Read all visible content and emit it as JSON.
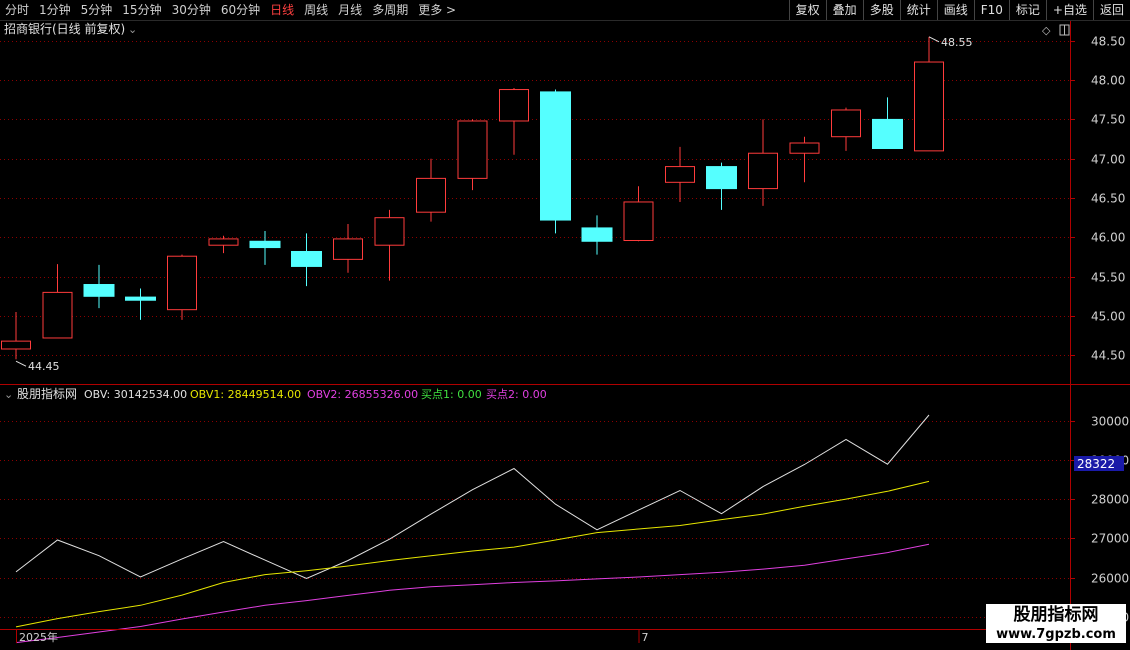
{
  "toolbar": {
    "periods": [
      "分时",
      "1分钟",
      "5分钟",
      "15分钟",
      "30分钟",
      "60分钟",
      "日线",
      "周线",
      "月线",
      "多周期",
      "更多 >"
    ],
    "active_index": 6,
    "buttons": [
      "复权",
      "叠加",
      "多股",
      "统计",
      "画线",
      "F10",
      "标记",
      "+自选",
      "返回"
    ]
  },
  "main_panel": {
    "title": "招商银行(日线 前复权)",
    "high_marker": "48.55",
    "low_marker": "44.45"
  },
  "indicator_panel": {
    "name": "股朋指标网",
    "legend": [
      {
        "label": "OBV: 30142534.00",
        "color": "#e0e0e0"
      },
      {
        "label": "OBV1: 28449514.00",
        "color": "#e6e600"
      },
      {
        "label": "OBV2: 26855326.00",
        "color": "#e040e0"
      },
      {
        "label": "买点1: 0.00",
        "color": "#40e040"
      },
      {
        "label": "买点2: 0.00",
        "color": "#e040e0"
      }
    ],
    "current_value_tag": "28322"
  },
  "x_axis": {
    "labels": [
      {
        "text": "2025年",
        "index": 0
      },
      {
        "text": "7",
        "index": 15
      }
    ]
  },
  "watermark": {
    "line1": "股朋指标网",
    "line2": "www.7gpzb.com"
  },
  "colors": {
    "up": "#ff3c3c",
    "down": "#55ffff",
    "grid": "#8b0000",
    "obv": "#e0e0e0",
    "obv1": "#e6e600",
    "obv2": "#e040e0"
  },
  "chart_data": [
    {
      "type": "candlestick",
      "title": "招商银行(日线 前复权)",
      "ylim": [
        44.3,
        48.65
      ],
      "y_ticks": [
        44.5,
        45.0,
        45.5,
        46.0,
        46.5,
        47.0,
        47.5,
        48.0,
        48.5
      ],
      "candles": [
        {
          "o": 44.58,
          "c": 44.68,
          "h": 45.05,
          "l": 44.45
        },
        {
          "o": 44.72,
          "c": 45.3,
          "h": 45.66,
          "l": 44.72
        },
        {
          "o": 45.4,
          "c": 45.25,
          "h": 45.65,
          "l": 45.1
        },
        {
          "o": 45.24,
          "c": 45.2,
          "h": 45.35,
          "l": 44.95
        },
        {
          "o": 45.08,
          "c": 45.76,
          "h": 45.78,
          "l": 44.95
        },
        {
          "o": 45.9,
          "c": 45.98,
          "h": 46.02,
          "l": 45.8
        },
        {
          "o": 45.95,
          "c": 45.87,
          "h": 46.08,
          "l": 45.65
        },
        {
          "o": 45.82,
          "c": 45.63,
          "h": 46.05,
          "l": 45.38
        },
        {
          "o": 45.72,
          "c": 45.98,
          "h": 46.17,
          "l": 45.55
        },
        {
          "o": 45.9,
          "c": 46.25,
          "h": 46.35,
          "l": 45.45
        },
        {
          "o": 46.32,
          "c": 46.75,
          "h": 47.0,
          "l": 46.2
        },
        {
          "o": 46.75,
          "c": 47.48,
          "h": 47.5,
          "l": 46.6
        },
        {
          "o": 47.48,
          "c": 47.88,
          "h": 47.9,
          "l": 47.05
        },
        {
          "o": 47.85,
          "c": 46.22,
          "h": 47.88,
          "l": 46.05
        },
        {
          "o": 46.12,
          "c": 45.95,
          "h": 46.28,
          "l": 45.78
        },
        {
          "o": 45.96,
          "c": 46.45,
          "h": 46.65,
          "l": 45.95
        },
        {
          "o": 46.7,
          "c": 46.9,
          "h": 47.15,
          "l": 46.45
        },
        {
          "o": 46.9,
          "c": 46.62,
          "h": 46.95,
          "l": 46.35
        },
        {
          "o": 46.62,
          "c": 47.07,
          "h": 47.5,
          "l": 46.4
        },
        {
          "o": 47.07,
          "c": 47.2,
          "h": 47.28,
          "l": 46.7
        },
        {
          "o": 47.28,
          "c": 47.62,
          "h": 47.65,
          "l": 47.1
        },
        {
          "o": 47.5,
          "c": 47.13,
          "h": 47.78,
          "l": 47.13
        },
        {
          "o": 47.1,
          "c": 48.23,
          "h": 48.55,
          "l": 47.1
        }
      ]
    },
    {
      "type": "line",
      "ylim": [
        24900,
        30700
      ],
      "y_ticks": [
        25000,
        26000,
        27000,
        28000,
        29000,
        30000
      ],
      "series": [
        {
          "name": "OBV",
          "values": [
            26150,
            26960,
            26560,
            26020,
            26480,
            26920,
            26450,
            25980,
            26440,
            26980,
            27620,
            28240,
            28780,
            27870,
            27220,
            27720,
            28220,
            27630,
            28320,
            28880,
            29520,
            28890,
            30140
          ]
        },
        {
          "name": "OBV1",
          "values": [
            24750,
            24960,
            25140,
            25300,
            25560,
            25880,
            26080,
            26180,
            26300,
            26440,
            26560,
            26680,
            26780,
            26960,
            27150,
            27240,
            27330,
            27480,
            27620,
            27820,
            28000,
            28200,
            28450
          ]
        },
        {
          "name": "OBV2",
          "values": [
            24350,
            24480,
            24620,
            24760,
            24950,
            25130,
            25300,
            25420,
            25550,
            25680,
            25770,
            25820,
            25880,
            25920,
            25970,
            26020,
            26080,
            26140,
            26220,
            26320,
            26480,
            26640,
            26850
          ]
        }
      ]
    }
  ]
}
